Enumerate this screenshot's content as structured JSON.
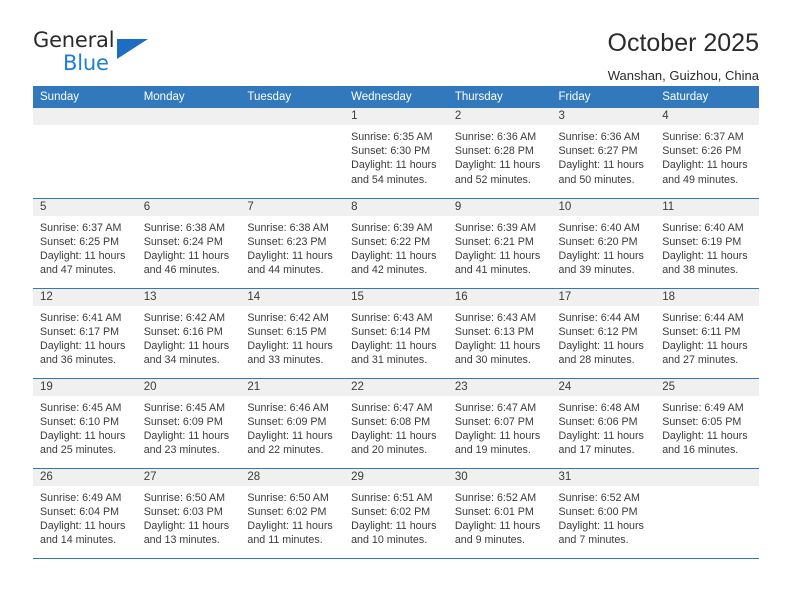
{
  "logo": {
    "general_text": "General",
    "blue_text": "Blue",
    "triangle_color": "#1b6ec2",
    "blue_color": "#1c7fd6"
  },
  "header": {
    "title": "October 2025",
    "subtitle": "Wanshan, Guizhou, China"
  },
  "theme": {
    "header_bg": "#3179bc",
    "header_text": "#ffffff",
    "day_band_bg": "#f0f0f0",
    "row_divider": "#3179bc"
  },
  "weekday_headers": [
    "Sunday",
    "Monday",
    "Tuesday",
    "Wednesday",
    "Thursday",
    "Friday",
    "Saturday"
  ],
  "weeks": [
    [
      {
        "day": "",
        "sunrise": "",
        "sunset": "",
        "daylight_line1": "",
        "daylight_line2": ""
      },
      {
        "day": "",
        "sunrise": "",
        "sunset": "",
        "daylight_line1": "",
        "daylight_line2": ""
      },
      {
        "day": "",
        "sunrise": "",
        "sunset": "",
        "daylight_line1": "",
        "daylight_line2": ""
      },
      {
        "day": "1",
        "sunrise": "Sunrise: 6:35 AM",
        "sunset": "Sunset: 6:30 PM",
        "daylight_line1": "Daylight: 11 hours",
        "daylight_line2": "and 54 minutes."
      },
      {
        "day": "2",
        "sunrise": "Sunrise: 6:36 AM",
        "sunset": "Sunset: 6:28 PM",
        "daylight_line1": "Daylight: 11 hours",
        "daylight_line2": "and 52 minutes."
      },
      {
        "day": "3",
        "sunrise": "Sunrise: 6:36 AM",
        "sunset": "Sunset: 6:27 PM",
        "daylight_line1": "Daylight: 11 hours",
        "daylight_line2": "and 50 minutes."
      },
      {
        "day": "4",
        "sunrise": "Sunrise: 6:37 AM",
        "sunset": "Sunset: 6:26 PM",
        "daylight_line1": "Daylight: 11 hours",
        "daylight_line2": "and 49 minutes."
      }
    ],
    [
      {
        "day": "5",
        "sunrise": "Sunrise: 6:37 AM",
        "sunset": "Sunset: 6:25 PM",
        "daylight_line1": "Daylight: 11 hours",
        "daylight_line2": "and 47 minutes."
      },
      {
        "day": "6",
        "sunrise": "Sunrise: 6:38 AM",
        "sunset": "Sunset: 6:24 PM",
        "daylight_line1": "Daylight: 11 hours",
        "daylight_line2": "and 46 minutes."
      },
      {
        "day": "7",
        "sunrise": "Sunrise: 6:38 AM",
        "sunset": "Sunset: 6:23 PM",
        "daylight_line1": "Daylight: 11 hours",
        "daylight_line2": "and 44 minutes."
      },
      {
        "day": "8",
        "sunrise": "Sunrise: 6:39 AM",
        "sunset": "Sunset: 6:22 PM",
        "daylight_line1": "Daylight: 11 hours",
        "daylight_line2": "and 42 minutes."
      },
      {
        "day": "9",
        "sunrise": "Sunrise: 6:39 AM",
        "sunset": "Sunset: 6:21 PM",
        "daylight_line1": "Daylight: 11 hours",
        "daylight_line2": "and 41 minutes."
      },
      {
        "day": "10",
        "sunrise": "Sunrise: 6:40 AM",
        "sunset": "Sunset: 6:20 PM",
        "daylight_line1": "Daylight: 11 hours",
        "daylight_line2": "and 39 minutes."
      },
      {
        "day": "11",
        "sunrise": "Sunrise: 6:40 AM",
        "sunset": "Sunset: 6:19 PM",
        "daylight_line1": "Daylight: 11 hours",
        "daylight_line2": "and 38 minutes."
      }
    ],
    [
      {
        "day": "12",
        "sunrise": "Sunrise: 6:41 AM",
        "sunset": "Sunset: 6:17 PM",
        "daylight_line1": "Daylight: 11 hours",
        "daylight_line2": "and 36 minutes."
      },
      {
        "day": "13",
        "sunrise": "Sunrise: 6:42 AM",
        "sunset": "Sunset: 6:16 PM",
        "daylight_line1": "Daylight: 11 hours",
        "daylight_line2": "and 34 minutes."
      },
      {
        "day": "14",
        "sunrise": "Sunrise: 6:42 AM",
        "sunset": "Sunset: 6:15 PM",
        "daylight_line1": "Daylight: 11 hours",
        "daylight_line2": "and 33 minutes."
      },
      {
        "day": "15",
        "sunrise": "Sunrise: 6:43 AM",
        "sunset": "Sunset: 6:14 PM",
        "daylight_line1": "Daylight: 11 hours",
        "daylight_line2": "and 31 minutes."
      },
      {
        "day": "16",
        "sunrise": "Sunrise: 6:43 AM",
        "sunset": "Sunset: 6:13 PM",
        "daylight_line1": "Daylight: 11 hours",
        "daylight_line2": "and 30 minutes."
      },
      {
        "day": "17",
        "sunrise": "Sunrise: 6:44 AM",
        "sunset": "Sunset: 6:12 PM",
        "daylight_line1": "Daylight: 11 hours",
        "daylight_line2": "and 28 minutes."
      },
      {
        "day": "18",
        "sunrise": "Sunrise: 6:44 AM",
        "sunset": "Sunset: 6:11 PM",
        "daylight_line1": "Daylight: 11 hours",
        "daylight_line2": "and 27 minutes."
      }
    ],
    [
      {
        "day": "19",
        "sunrise": "Sunrise: 6:45 AM",
        "sunset": "Sunset: 6:10 PM",
        "daylight_line1": "Daylight: 11 hours",
        "daylight_line2": "and 25 minutes."
      },
      {
        "day": "20",
        "sunrise": "Sunrise: 6:45 AM",
        "sunset": "Sunset: 6:09 PM",
        "daylight_line1": "Daylight: 11 hours",
        "daylight_line2": "and 23 minutes."
      },
      {
        "day": "21",
        "sunrise": "Sunrise: 6:46 AM",
        "sunset": "Sunset: 6:09 PM",
        "daylight_line1": "Daylight: 11 hours",
        "daylight_line2": "and 22 minutes."
      },
      {
        "day": "22",
        "sunrise": "Sunrise: 6:47 AM",
        "sunset": "Sunset: 6:08 PM",
        "daylight_line1": "Daylight: 11 hours",
        "daylight_line2": "and 20 minutes."
      },
      {
        "day": "23",
        "sunrise": "Sunrise: 6:47 AM",
        "sunset": "Sunset: 6:07 PM",
        "daylight_line1": "Daylight: 11 hours",
        "daylight_line2": "and 19 minutes."
      },
      {
        "day": "24",
        "sunrise": "Sunrise: 6:48 AM",
        "sunset": "Sunset: 6:06 PM",
        "daylight_line1": "Daylight: 11 hours",
        "daylight_line2": "and 17 minutes."
      },
      {
        "day": "25",
        "sunrise": "Sunrise: 6:49 AM",
        "sunset": "Sunset: 6:05 PM",
        "daylight_line1": "Daylight: 11 hours",
        "daylight_line2": "and 16 minutes."
      }
    ],
    [
      {
        "day": "26",
        "sunrise": "Sunrise: 6:49 AM",
        "sunset": "Sunset: 6:04 PM",
        "daylight_line1": "Daylight: 11 hours",
        "daylight_line2": "and 14 minutes."
      },
      {
        "day": "27",
        "sunrise": "Sunrise: 6:50 AM",
        "sunset": "Sunset: 6:03 PM",
        "daylight_line1": "Daylight: 11 hours",
        "daylight_line2": "and 13 minutes."
      },
      {
        "day": "28",
        "sunrise": "Sunrise: 6:50 AM",
        "sunset": "Sunset: 6:02 PM",
        "daylight_line1": "Daylight: 11 hours",
        "daylight_line2": "and 11 minutes."
      },
      {
        "day": "29",
        "sunrise": "Sunrise: 6:51 AM",
        "sunset": "Sunset: 6:02 PM",
        "daylight_line1": "Daylight: 11 hours",
        "daylight_line2": "and 10 minutes."
      },
      {
        "day": "30",
        "sunrise": "Sunrise: 6:52 AM",
        "sunset": "Sunset: 6:01 PM",
        "daylight_line1": "Daylight: 11 hours",
        "daylight_line2": "and 9 minutes."
      },
      {
        "day": "31",
        "sunrise": "Sunrise: 6:52 AM",
        "sunset": "Sunset: 6:00 PM",
        "daylight_line1": "Daylight: 11 hours",
        "daylight_line2": "and 7 minutes."
      },
      {
        "day": "",
        "sunrise": "",
        "sunset": "",
        "daylight_line1": "",
        "daylight_line2": ""
      }
    ]
  ]
}
